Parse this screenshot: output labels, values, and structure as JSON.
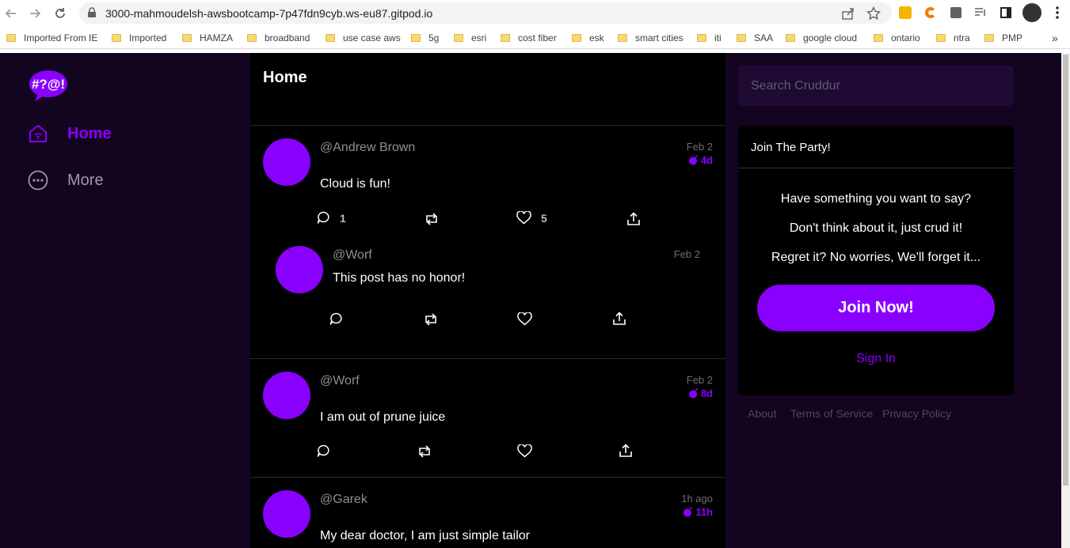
{
  "browser": {
    "url": "3000-mahmoudelsh-awsbootcamp-7p47fdn9cyb.ws-eu87.gitpod.io",
    "bookmarks": [
      "Imported From IE",
      "Imported",
      "HAMZA",
      "broadband",
      "use case aws",
      "5g",
      "esri",
      "cost fiber",
      "esk",
      "smart cities",
      "iti",
      "SAA",
      "google cloud",
      "ontario",
      "ntra",
      "PMP"
    ],
    "more_bookmarks": "»"
  },
  "app": {
    "logo_text": "#?@!",
    "accent": "#8a00ff",
    "sidebar": {
      "items": [
        {
          "label": "Home",
          "icon": "home-icon",
          "active": true
        },
        {
          "label": "More",
          "icon": "more-icon",
          "active": false
        }
      ]
    },
    "feed": {
      "title": "Home",
      "posts": [
        {
          "handle": "@Andrew Brown",
          "message": "Cloud is fun!",
          "date": "Feb 2",
          "expires": "4d",
          "replies": "1",
          "likes": "5"
        },
        {
          "handle": "@Worf",
          "message": "This post has no honor!",
          "date": "Feb 2",
          "reply": true
        },
        {
          "handle": "@Worf",
          "message": "I am out of prune juice",
          "date": "Feb 2",
          "expires": "8d"
        },
        {
          "handle": "@Garek",
          "message": "My dear doctor, I am just simple tailor",
          "date": "1h ago",
          "expires": "11h"
        }
      ]
    },
    "search": {
      "placeholder": "Search Cruddur"
    },
    "join": {
      "title": "Join The Party!",
      "lines": [
        "Have something you want to say?",
        "Don't think about it, just crud it!",
        "Regret it? No worries, We'll forget it..."
      ],
      "button": "Join Now!",
      "signin": "Sign In"
    },
    "footer": {
      "links": [
        "About",
        "Terms of Service",
        "Privacy Policy"
      ]
    }
  }
}
